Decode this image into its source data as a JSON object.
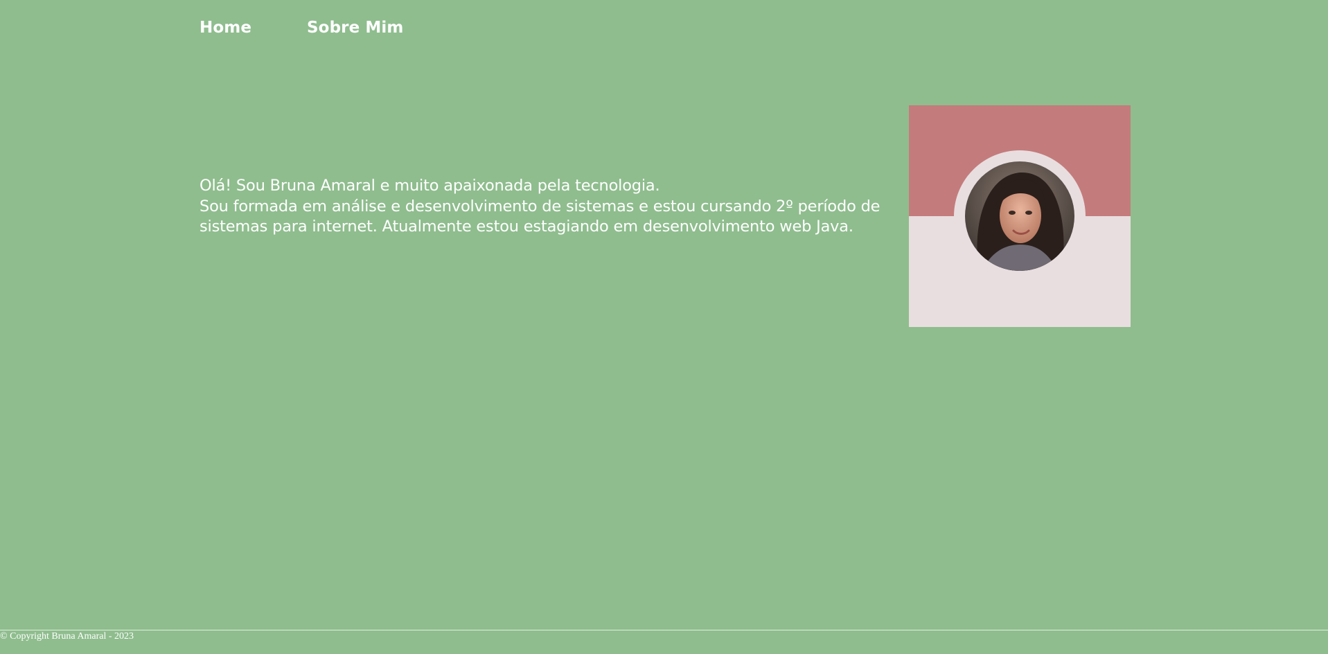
{
  "nav": {
    "items": [
      {
        "label": "Home"
      },
      {
        "label": "Sobre Mim"
      }
    ]
  },
  "intro": {
    "line1": "Olá! Sou Bruna Amaral e muito apaixonada pela tecnologia.",
    "line2": "Sou formada em análise e desenvolvimento de sistemas e estou cursando 2º período de sistemas para internet. Atualmente estou estagiando em desenvolvimento web Java."
  },
  "footer": {
    "copyright": "© Copyright Bruna Amaral - 2023"
  },
  "colors": {
    "background": "#8fbd8e",
    "text": "#ffffff",
    "card_top": "#c47b7c",
    "card_bottom": "#e8dedf"
  }
}
